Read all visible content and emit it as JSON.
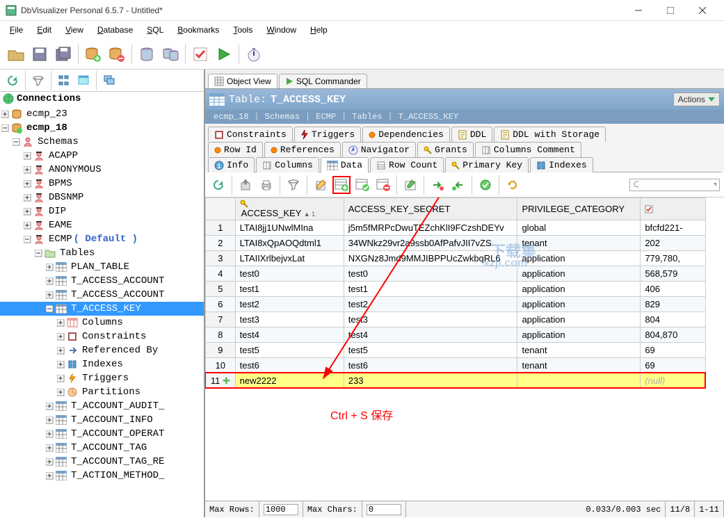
{
  "window": {
    "title": "DbVisualizer Personal 6.5.7 - Untitled*"
  },
  "menu": [
    "File",
    "Edit",
    "View",
    "Database",
    "SQL",
    "Bookmarks",
    "Tools",
    "Window",
    "Help"
  ],
  "connections": {
    "title": "Connections",
    "items": [
      "ecmp_23"
    ],
    "active": {
      "name": "ecmp_18",
      "schemas_label": "Schemas",
      "schemas": [
        "ACAPP",
        "ANONYMOUS",
        "BPMS",
        "DBSNMP",
        "DIP",
        "EAME"
      ],
      "default_schema": "ECMP",
      "default_tag": "( Default )",
      "tables_label": "Tables",
      "tables_before": [
        "PLAN_TABLE",
        "T_ACCESS_ACCOUNT",
        "T_ACCESS_ACCOUNT"
      ],
      "selected_table": "T_ACCESS_KEY",
      "under_table": [
        {
          "label": "Columns",
          "icon": "columns"
        },
        {
          "label": "Constraints",
          "icon": "constraint"
        },
        {
          "label": "Referenced By",
          "icon": "ref"
        },
        {
          "label": "Indexes",
          "icon": "index"
        },
        {
          "label": "Triggers",
          "icon": "trigger"
        },
        {
          "label": "Partitions",
          "icon": "partition"
        }
      ],
      "tables_after": [
        "T_ACCOUNT_AUDIT_",
        "T_ACCOUNT_INFO",
        "T_ACCOUNT_OPERAT",
        "T_ACCOUNT_TAG",
        "T_ACCOUNT_TAG_RE",
        "T_ACTION_METHOD_"
      ]
    }
  },
  "objectview": {
    "tab1": "Object View",
    "tab2": "SQL Commander",
    "header_prefix": "Table:",
    "header_name": "T_ACCESS_KEY",
    "actions": "Actions",
    "breadcrumb": [
      "ecmp_18",
      "Schemas",
      "ECMP",
      "Tables",
      "T_ACCESS_KEY"
    ],
    "subtabs_row1": [
      "Constraints",
      "Triggers",
      "Dependencies",
      "DDL",
      "DDL with Storage"
    ],
    "subtabs_row2": [
      "Row Id",
      "References",
      "Navigator",
      "Grants",
      "Columns Comment"
    ],
    "subtabs_row3": [
      "Info",
      "Columns",
      "Data",
      "Row Count",
      "Primary Key",
      "Indexes"
    ],
    "active_subtab": "Data",
    "quickfilter_placeholder": ""
  },
  "grid": {
    "columns": [
      "ACCESS_KEY",
      "ACCESS_KEY_SECRET",
      "PRIVILEGE_CATEGORY",
      ""
    ],
    "sort_col": 0,
    "rows": [
      {
        "n": "1",
        "c": [
          "LTAI8jj1UNwlMIna",
          "j5m5fMRPcDwuTEZchKlI9FCzshDEYv",
          "global",
          "bfcfd221-"
        ]
      },
      {
        "n": "2",
        "c": [
          "LTAI8xQpAOQdtml1",
          "34WNkz29vr2a9ssb0AfPafvJII7vZS",
          "tenant",
          "202"
        ]
      },
      {
        "n": "3",
        "c": [
          "LTAIIXrlbejvxLat",
          "NXGNz8Jmd9MMJIBPPUcZwkbqRL6",
          "application",
          "779,780,"
        ]
      },
      {
        "n": "4",
        "c": [
          "test0",
          "test0",
          "application",
          "568,579"
        ]
      },
      {
        "n": "5",
        "c": [
          "test1",
          "test1",
          "application",
          "406"
        ]
      },
      {
        "n": "6",
        "c": [
          "test2",
          "test2",
          "application",
          "829"
        ]
      },
      {
        "n": "7",
        "c": [
          "test3",
          "test3",
          "application",
          "804"
        ]
      },
      {
        "n": "8",
        "c": [
          "test4",
          "test4",
          "application",
          "804,870"
        ]
      },
      {
        "n": "9",
        "c": [
          "test5",
          "test5",
          "tenant",
          "69"
        ]
      },
      {
        "n": "10",
        "c": [
          "test6",
          "test6",
          "tenant",
          "69"
        ]
      }
    ],
    "newrow": {
      "n": "11",
      "c": [
        "new2222",
        "233",
        "",
        "(null)"
      ]
    }
  },
  "status": {
    "maxrows_label": "Max Rows:",
    "maxrows": "1000",
    "maxchars_label": "Max Chars:",
    "maxchars": "0",
    "time": "0.033/0.003 sec",
    "pos": "11/8",
    "range": "1-11"
  },
  "annotation": "Ctrl + S 保存",
  "watermark1": "下载集",
  "watermark2": "xzji.com"
}
